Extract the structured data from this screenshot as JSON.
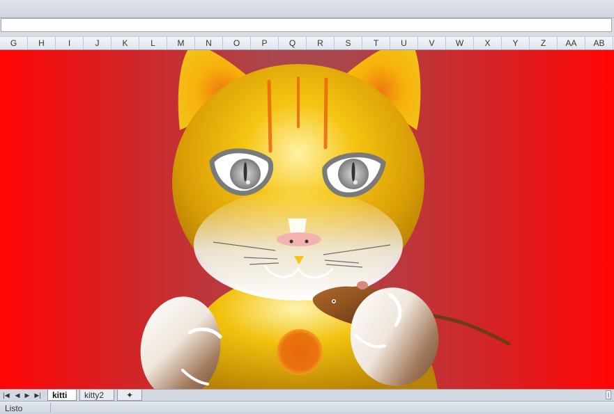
{
  "columns": [
    "G",
    "H",
    "I",
    "J",
    "K",
    "L",
    "M",
    "N",
    "O",
    "P",
    "Q",
    "R",
    "S",
    "T",
    "U",
    "V",
    "W",
    "X",
    "Y",
    "Z",
    "AA",
    "AB"
  ],
  "sheet_tabs": [
    {
      "label": "kitti",
      "active": true
    },
    {
      "label": "kitty2",
      "active": false
    }
  ],
  "status": {
    "text": "Listo"
  },
  "colors": {
    "background_edge": "#ff0505",
    "background_center": "#a9474d",
    "cat_fur": "#f2b705",
    "cat_spot": "#e8720e",
    "mouse": "#8a4a1a"
  },
  "icons": {
    "nav_first": "first-sheet-icon",
    "nav_prev": "prev-sheet-icon",
    "nav_next": "next-sheet-icon",
    "nav_last": "last-sheet-icon",
    "new_sheet": "insert-sheet-icon"
  }
}
